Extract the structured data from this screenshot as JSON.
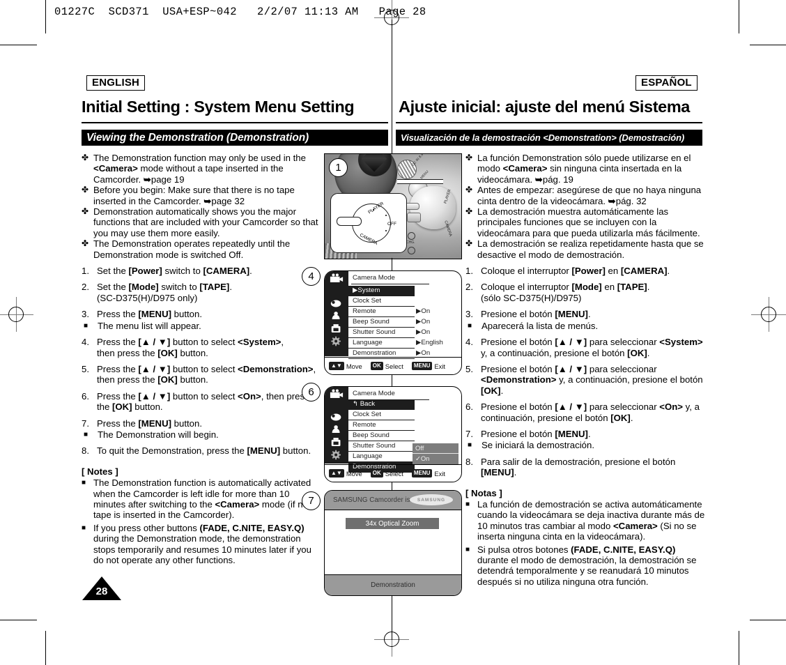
{
  "prepress": {
    "slug": "01227C  SCD371  USA+ESP~042   2/2/07 11:13 AM   Page 28"
  },
  "header": {
    "lang_en": "ENGLISH",
    "lang_es": "ESPAÑOL",
    "title_en": "Initial Setting : System Menu Setting",
    "title_es": "Ajuste inicial: ajuste del menú Sistema",
    "section_en": "Viewing the Demonstration (Demonstration)",
    "section_es": "Visualización de la demostración <Demonstration> (Demostración)"
  },
  "english": {
    "bullet_glyph": "✤",
    "square_glyph": "■",
    "arrow_glyph": "➥",
    "bullets": [
      "The Demonstration function may only be used in the <b>&lt;Camera&gt;</b> mode without a tape inserted in the Camcorder. <b>➥</b>page 19",
      "Before you begin: Make sure that there is no tape inserted in the Camcorder. <b>➥</b>page 32",
      "Demonstration automatically shows you the major functions that are included with your Camcorder so that you may use them more easily.",
      "The Demonstration operates repeatedly until the Demonstration mode is switched Off."
    ],
    "steps": [
      {
        "n": "1.",
        "text": "Set the <b>[Power]</b> switch to <b>[CAMERA]</b>."
      },
      {
        "n": "2.",
        "text": "Set the <b>[Mode]</b> switch to <b>[TAPE]</b>.<br>(SC-D375(H)/D975 only)"
      },
      {
        "n": "3.",
        "text": "Press the <b>[MENU]</b> button.",
        "sub": "The menu list will appear."
      },
      {
        "n": "4.",
        "text": "Press the <b>[▲ / ▼]</b> button to select <b>&lt;System&gt;</b>,<br>then press the <b>[OK]</b> button."
      },
      {
        "n": "5.",
        "text": "Press the <b>[▲ / ▼]</b> button to select <b>&lt;Demonstration&gt;</b>,<br>then press the <b>[OK]</b> button."
      },
      {
        "n": "6.",
        "text": "Press the <b>[▲ / ▼]</b> button to select <b>&lt;On&gt;</b>, then press the <b>[OK]</b> button."
      },
      {
        "n": "7.",
        "text": "Press the <b>[MENU]</b> button.",
        "sub": "The Demonstration will begin."
      },
      {
        "n": "8.",
        "text": "To quit the Demonstration, press the <b>[MENU]</b> button."
      }
    ],
    "notes_heading": "[ Notes ]",
    "notes": [
      "The Demonstration function is automatically activated when the Camcorder is left idle for more than 10 minutes after switching to the <b>&lt;Camera&gt;</b> mode (if no tape is inserted in the Camcorder).",
      "If you press other buttons <b>(FADE, C.NITE, EASY.Q)</b> during the Demonstration mode, the demonstration stops temporarily and resumes 10 minutes later if you do not operate any other functions."
    ]
  },
  "spanish": {
    "bullets": [
      "La función Demonstration sólo puede utilizarse en el modo <b>&lt;Camera&gt;</b> sin ninguna cinta insertada en la videocámara. <b>➥</b>pág. 19",
      "Antes de empezar: asegúrese de que no haya ninguna cinta dentro de la videocámara. <b>➥</b>pág. 32",
      "La demostración muestra automáticamente las principales funciones que se incluyen con la videocámara para que pueda utilizarla más fácilmente.",
      "La demostración se realiza repetidamente hasta que se desactive el modo de demostración."
    ],
    "steps": [
      {
        "n": "1.",
        "text": "Coloque el interruptor <b>[Power]</b> en <b>[CAMERA]</b>."
      },
      {
        "n": "2.",
        "text": "Coloque el interruptor <b>[Mode]</b> en <b>[TAPE]</b>.<br>(sólo SC-D375(H)/D975)"
      },
      {
        "n": "3.",
        "text": "Presione el botón <b>[MENU]</b>.",
        "sub": "Aparecerá la lista de menús."
      },
      {
        "n": "4.",
        "text": "Presione el botón <b>[▲ / ▼]</b> para seleccionar <b>&lt;System&gt;</b> y, a continuación, presione el botón <b>[OK]</b>."
      },
      {
        "n": "5.",
        "text": "Presione el botón <b>[▲ / ▼]</b> para seleccionar <b>&lt;Demonstration&gt;</b> y, a continuación, presione el botón <b>[OK]</b>."
      },
      {
        "n": "6.",
        "text": "Presione el botón <b>[▲ / ▼]</b> para seleccionar <b>&lt;On&gt;</b> y, a continuación, presione el botón <b>[OK]</b>."
      },
      {
        "n": "7.",
        "text": "Presione el botón <b>[MENU]</b>.",
        "sub": "Se iniciará la demostración."
      },
      {
        "n": "8.",
        "text": "Para salir de la demostración, presione el botón <b>[MENU]</b>."
      }
    ],
    "notes_heading": "[ Notas ]",
    "notes": [
      "La función de demostración se activa automáticamente cuando la videocámara se deja inactiva durante más de 10 minutos tras cambiar al modo <b>&lt;Camera&gt;</b> (Si no se inserta ninguna cinta en la videocámara).",
      "Si pulsa otros botones <b>(FADE, C.NITE, EASY.Q)</b> durante el modo de demostración, la demostración se detendrá temporalmente y se reanudará 10 minutos después si no utiliza ninguna otra función."
    ]
  },
  "callouts": {
    "one": "1",
    "four": "4",
    "six": "6",
    "seven": "7"
  },
  "photo": {
    "switch_labels": {
      "player": "PLAYER",
      "off": "OFF",
      "camera": "CAMERA"
    },
    "body_labels": {
      "dcin": "DC IN 8.4V",
      "menu": "MENU",
      "chg": "CHG."
    },
    "dial_labels": {
      "player": "PLAYER",
      "camera": "CAMERA"
    }
  },
  "lcd1": {
    "mode_title": "Camera Mode",
    "rows": [
      {
        "label": "▶System",
        "value": "",
        "selected": true
      },
      {
        "label": "Clock Set",
        "value": "",
        "selected": false
      },
      {
        "label": "Remote",
        "value": "▶On",
        "selected": false
      },
      {
        "label": "Beep Sound",
        "value": "▶On",
        "selected": false
      },
      {
        "label": "Shutter Sound",
        "value": "▶On",
        "selected": false
      },
      {
        "label": "Language",
        "value": "▶English",
        "selected": false
      },
      {
        "label": "Demonstration",
        "value": "▶On",
        "selected": false
      }
    ],
    "footer": {
      "move": "Move",
      "ok_key": "OK",
      "select": "Select",
      "menu_key": "MENU",
      "exit": "Exit"
    }
  },
  "lcd2": {
    "mode_title": "Camera Mode",
    "rows": [
      {
        "label": "Back",
        "selected": true
      },
      {
        "label": "Clock Set",
        "selected": false
      },
      {
        "label": "Remote",
        "selected": false
      },
      {
        "label": "Beep Sound",
        "selected": false
      },
      {
        "label": "Shutter Sound",
        "selected": false
      },
      {
        "label": "Language",
        "selected": false
      },
      {
        "label": "Demonstration",
        "selected": true
      }
    ],
    "popup": {
      "off": "Off",
      "on": "✓On"
    },
    "footer": {
      "move": "Move",
      "ok_key": "OK",
      "select": "Select",
      "menu_key": "MENU",
      "exit": "Exit"
    }
  },
  "lcd3": {
    "top_text": "SAMSUNG Camcorder is...",
    "brand": "SAMSUNG",
    "band_text": "34x Optical Zoom",
    "bottom_text": "Demonstration"
  },
  "page_number": "28"
}
